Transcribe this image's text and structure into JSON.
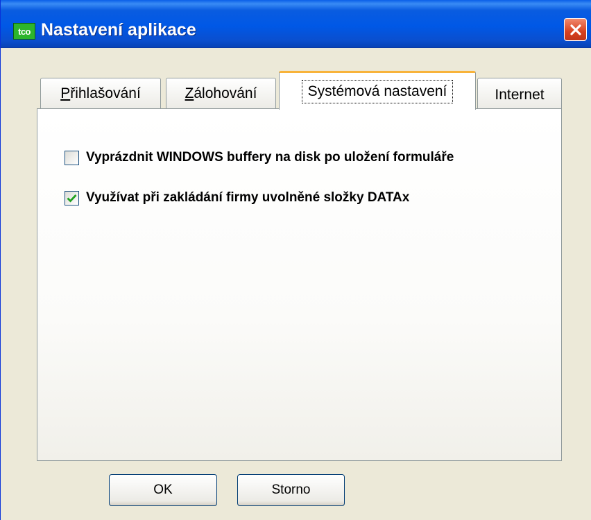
{
  "window": {
    "title": "Nastavení aplikace",
    "app_icon_text": "tco",
    "close_icon": "close-icon"
  },
  "tabs": [
    {
      "label_first": "P",
      "label_rest": "řihlašování",
      "selected": false
    },
    {
      "label_first": "Z",
      "label_rest": "álohování",
      "selected": false
    },
    {
      "label": "Systémová nastavení",
      "selected": true
    },
    {
      "label": "Internet",
      "selected": false
    }
  ],
  "settings": {
    "flush_buffers": {
      "label": "Vyprázdnit WINDOWS buffery na disk po uložení formuláře",
      "checked": false
    },
    "reuse_folders": {
      "label": "Využívat při zakládání firmy uvolněné složky DATAx",
      "checked": true
    }
  },
  "buttons": {
    "ok": "OK",
    "cancel": "Storno"
  },
  "colors": {
    "titlebar": "#0058e6",
    "active_tab_accent": "#f8b33a",
    "checkmark": "#21a121",
    "close_button": "#d8411f"
  }
}
